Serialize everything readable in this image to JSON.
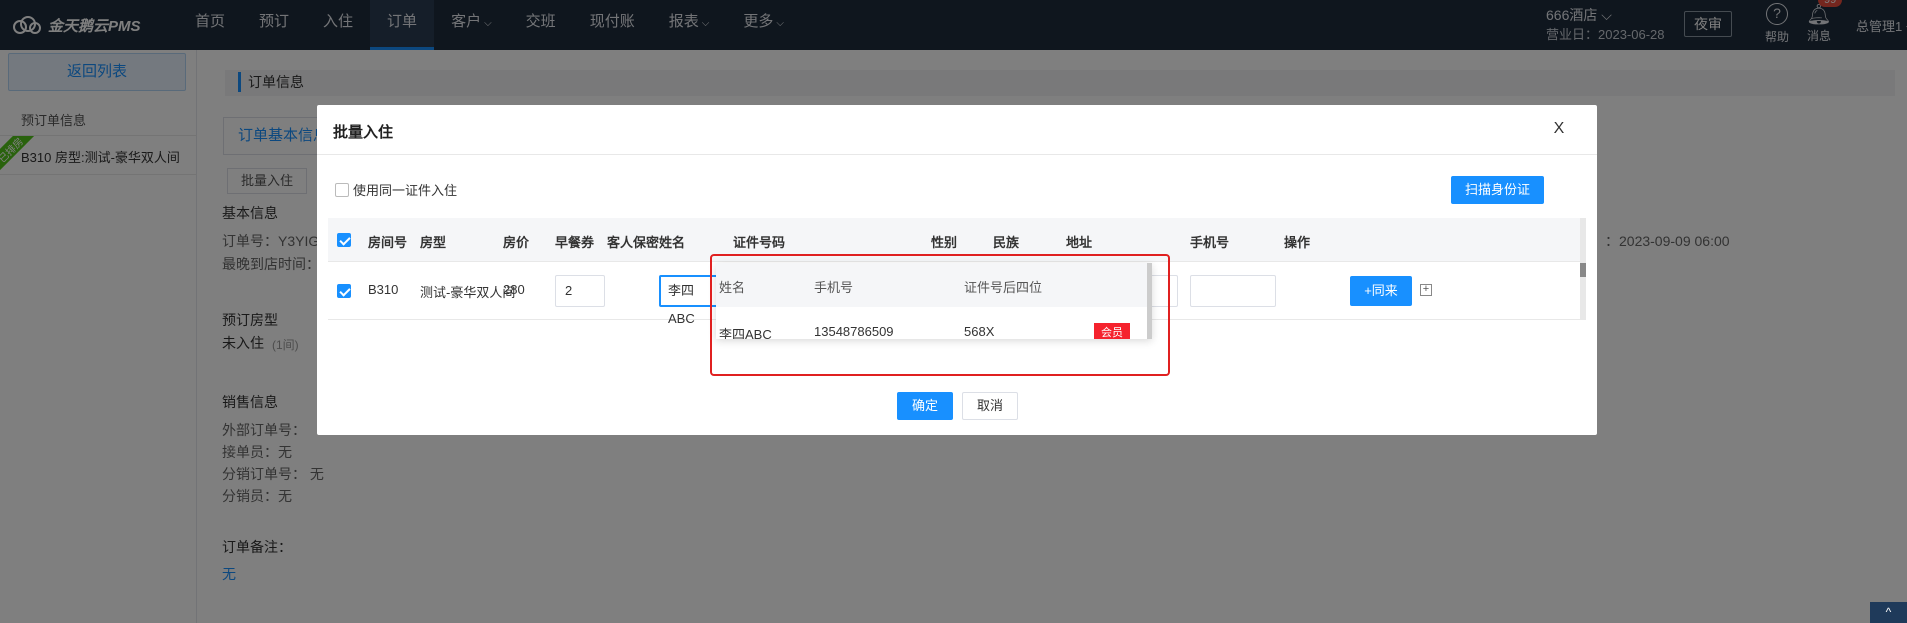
{
  "app": {
    "logo_text": "金天鹅云PMS"
  },
  "nav": {
    "items": [
      {
        "label": "首页",
        "caret": ""
      },
      {
        "label": "预订",
        "caret": ""
      },
      {
        "label": "入住",
        "caret": ""
      },
      {
        "label": "订单",
        "caret": ""
      },
      {
        "label": "客户",
        "caret": "⌵"
      },
      {
        "label": "交班",
        "caret": ""
      },
      {
        "label": "现付账",
        "caret": ""
      },
      {
        "label": "报表",
        "caret": "⌵"
      },
      {
        "label": "更多",
        "caret": "⌵"
      }
    ],
    "active_index": 3
  },
  "header": {
    "hotel": "666酒店 ⌵",
    "biz_date": "营业日：2023-06-28",
    "night_audit": "夜审",
    "help": "帮助",
    "help_symbol": "?",
    "messages": "消息",
    "message_count": "99",
    "user": "总管理1 ⌵"
  },
  "sidebar": {
    "back": "返回列表",
    "title": "预订单信息",
    "ribbon": "已排房",
    "room": "B310  房型:测试-豪华双人间"
  },
  "main": {
    "section_title": "订单信息",
    "tab_basic": "订单基本信息",
    "batch_checkin": "批量入住",
    "basic_info": "基本信息",
    "order_no": "订单号：Y3YIG",
    "latest_arrival": "最晚到店时间：",
    "depart_time": "：2023-09-09 06:00",
    "booked_room_type": "预订房型",
    "not_checked_in": "未入住",
    "rooms_count": "(1间)",
    "sales_info": "销售信息",
    "external_order": "外部订单号：",
    "receiver": "接单员：无",
    "dist_order": "分销订单号：  无",
    "dist_person": "分销员：无",
    "remark_label": "订单备注：",
    "remark_value": "无"
  },
  "modal": {
    "title": "批量入住",
    "close": "X",
    "same_id_label": "使用同一证件入住",
    "scan_id": "扫描身份证",
    "columns": [
      "房间号",
      "房型",
      "房价",
      "早餐券",
      "客人保密",
      "姓名",
      "证件号码",
      "性别",
      "民族",
      "地址",
      "手机号",
      "操作"
    ],
    "row": {
      "room_no": "B310",
      "room_type": "测试-豪华双人间",
      "price": "280",
      "breakfast": "2",
      "name": "李四ABC",
      "address_placeholder": "请输入",
      "same_guest_btn": "+同来",
      "expand_symbol": "+"
    },
    "confirm": "确定",
    "cancel": "取消"
  },
  "popup": {
    "columns": [
      "姓名",
      "手机号",
      "证件号后四位"
    ],
    "rows": [
      {
        "name": "李四ABC",
        "phone": "13548786509",
        "id_last4": "568X",
        "tag": "会员"
      }
    ]
  },
  "corner": "^",
  "colors": {
    "primary": "#1890ff",
    "nav_bg": "#1f2d3d",
    "highlight": "#e02020",
    "member_tag": "#f5222d"
  }
}
